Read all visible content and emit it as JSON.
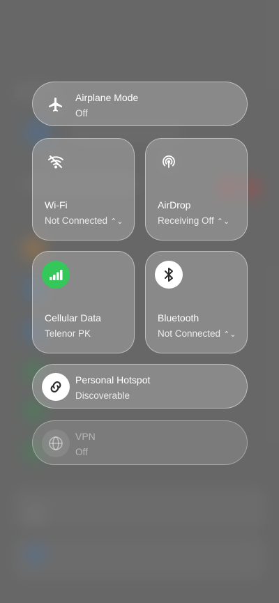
{
  "airplane": {
    "title": "Airplane Mode",
    "status": "Off"
  },
  "wifi": {
    "title": "Wi-Fi",
    "status": "Not Connected",
    "chevron": "⌃⌄"
  },
  "airdrop": {
    "title": "AirDrop",
    "status": "Receiving Off",
    "chevron": "⌃⌄"
  },
  "cellular": {
    "title": "Cellular Data",
    "status": "Telenor PK"
  },
  "bluetooth": {
    "title": "Bluetooth",
    "status": "Not Connected",
    "chevron": "⌃⌄"
  },
  "hotspot": {
    "title": "Personal Hotspot",
    "status": "Discoverable"
  },
  "vpn": {
    "title": "VPN",
    "status": "Off"
  },
  "colors": {
    "cellular_active": "#34c759",
    "icon_inactive": "#8e8e8e",
    "icon_active_white": "#ffffff"
  }
}
